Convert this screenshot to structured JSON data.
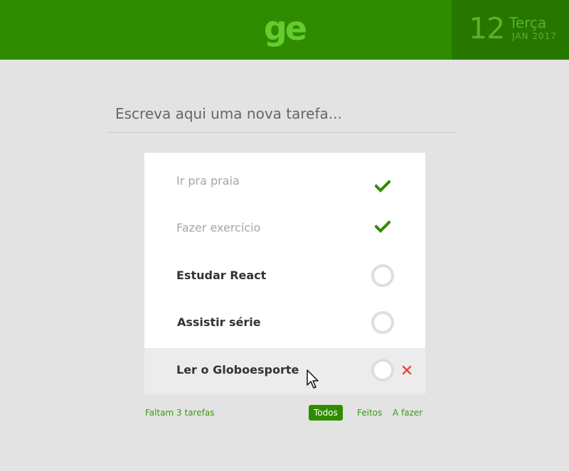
{
  "header": {
    "logo": "ge",
    "date": {
      "day": "12",
      "weekday": "Terça",
      "month_year": "JAN 2017"
    }
  },
  "new_task": {
    "placeholder": "Escreva aqui uma nova tarefa..."
  },
  "todos": [
    {
      "text": "Ir pra praia",
      "done": true
    },
    {
      "text": "Fazer exercício",
      "done": true
    },
    {
      "text": "Estudar React",
      "done": false
    },
    {
      "text": "Assistir série",
      "done": false
    },
    {
      "text": "Ler o Globoesporte",
      "done": false
    }
  ],
  "footer": {
    "remaining": "Faltam 3 tarefas",
    "filters": [
      "Todos",
      "Feitos",
      "A fazer"
    ],
    "active_filter": "Todos"
  },
  "colors": {
    "header_bg": "#2f8c00",
    "date_bg": "#277600",
    "logo": "#64cc2c",
    "accent": "#3b9a10",
    "check": "#2f8c00",
    "remove": "#e8453c"
  },
  "icons": {
    "done": "check-icon",
    "pending": "circle-toggle-icon",
    "delete": "close-icon",
    "cursor": "mouse-pointer-icon"
  }
}
